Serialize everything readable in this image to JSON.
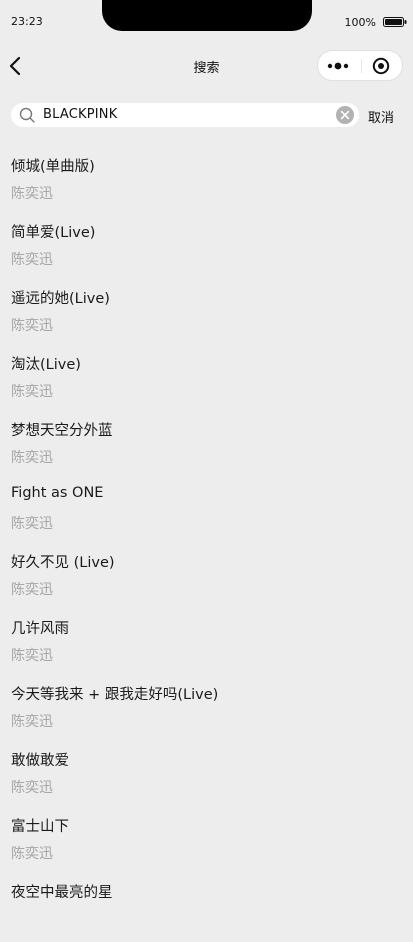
{
  "status_bar": {
    "time": "23:23",
    "battery": "100%"
  },
  "nav": {
    "title": "搜索"
  },
  "search": {
    "query": "BLACKPINK",
    "cancel_label": "取消"
  },
  "results": [
    {
      "title": "倾城(单曲版)",
      "artist": "陈奕迅"
    },
    {
      "title": "简单爱(Live)",
      "artist": "陈奕迅"
    },
    {
      "title": "遥远的她(Live)",
      "artist": "陈奕迅"
    },
    {
      "title": "淘汰(Live)",
      "artist": "陈奕迅"
    },
    {
      "title": "梦想天空分外蓝",
      "artist": "陈奕迅"
    },
    {
      "title": "Fight as ONE",
      "artist": "陈奕迅"
    },
    {
      "title": "好久不见 (Live)",
      "artist": "陈奕迅"
    },
    {
      "title": "几许风雨",
      "artist": "陈奕迅"
    },
    {
      "title": "今天等我来 + 跟我走好吗(Live)",
      "artist": "陈奕迅"
    },
    {
      "title": "敢做敢爱",
      "artist": "陈奕迅"
    },
    {
      "title": "富士山下",
      "artist": "陈奕迅"
    },
    {
      "title": "夜空中最亮的星",
      "artist": ""
    }
  ]
}
